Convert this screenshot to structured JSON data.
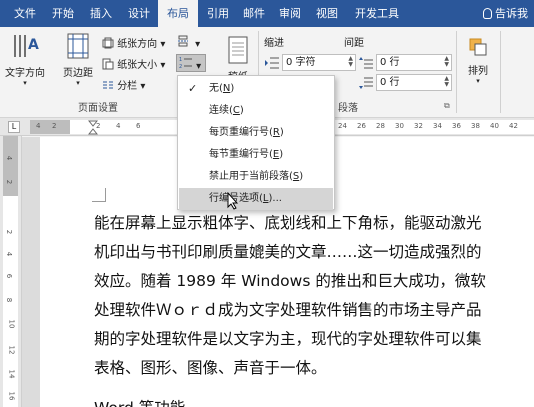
{
  "ribbon_tabs": [
    {
      "label": "文件"
    },
    {
      "label": "开始"
    },
    {
      "label": "插入"
    },
    {
      "label": "设计"
    },
    {
      "label": "布局",
      "active": true
    },
    {
      "label": "引用"
    },
    {
      "label": "邮件"
    },
    {
      "label": "审阅"
    },
    {
      "label": "视图"
    },
    {
      "label": "开发工具"
    }
  ],
  "tell_me": "告诉我",
  "page_setup": {
    "text_direction": "文字方向",
    "margins": "页边距",
    "orientation": "纸张方向",
    "size": "纸张大小",
    "columns": "分栏",
    "group_label": "页面设置"
  },
  "manuscript_label": "稿纸",
  "paragraph": {
    "indent_title": "缩进",
    "spacing_title": "间距",
    "indent_left_value": "0 字符",
    "spacing_before_value": "0 行",
    "spacing_after_value": "0 行",
    "group_label": "段落",
    "arrange_label": "排列"
  },
  "line_numbers_menu": {
    "items": [
      {
        "text": "无",
        "hotkey": "N",
        "checked": true
      },
      {
        "text": "连续",
        "hotkey": "C"
      },
      {
        "text": "每页重编行号",
        "hotkey": "R"
      },
      {
        "text": "每节重编行号",
        "hotkey": "E"
      },
      {
        "text": "禁止用于当前段落",
        "hotkey": "S"
      },
      {
        "text": "行编号选项",
        "hotkey": "L",
        "suffix": "...",
        "hovered": true
      }
    ]
  },
  "ruler": {
    "tab_marker": "L",
    "h_numbers": [
      "4",
      "2",
      "2",
      "4",
      "6",
      "24",
      "26",
      "28",
      "30",
      "32",
      "34",
      "36",
      "38",
      "40",
      "42"
    ],
    "v_numbers": [
      "4",
      "2",
      "2",
      "4",
      "6",
      "8",
      "10",
      "12",
      "14",
      "16"
    ]
  },
  "document": {
    "lines": [
      "能在屏幕上显示粗体字、底划线和上下角标，能驱动激光",
      "机印出与书刊印刷质量媲美的文章……这一切造成强烈的",
      "效应。随着 1989 年 Windows 的推出和巨大成功，微软",
      "处理软件Ｗｏｒｄ成为文字处理软件销售的市场主导产品",
      "期的字处理软件是以文字为主，现代的字处理软件可以集",
      "表格、图形、图像、声音于一体。",
      "Word 等功能"
    ]
  },
  "colors": {
    "ribbon_blue": "#2b579a",
    "menu_hover": "#d5d5d5"
  }
}
